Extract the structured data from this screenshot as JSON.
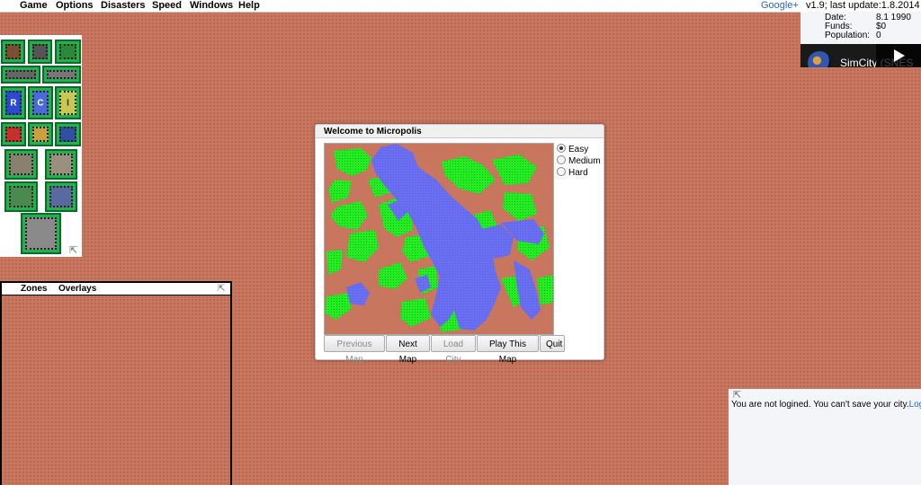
{
  "menubar": {
    "items": [
      "Game",
      "Options",
      "Disasters",
      "Speed",
      "Windows",
      "Help"
    ],
    "google_plus": "Google+",
    "version": "v1.9; last update:1.8.2014"
  },
  "status": {
    "date_label": "Date:",
    "date_value": "8.1 1990",
    "funds_label": "Funds:",
    "funds_value": "$0",
    "population_label": "Population:",
    "population_value": "0",
    "video_title": "SimCity (SNES"
  },
  "zones_panel": {
    "tabs": [
      "Zones",
      "Overlays"
    ]
  },
  "dialog": {
    "title": "Welcome to Micropolis",
    "difficulty": {
      "options": [
        "Easy",
        "Medium",
        "Hard"
      ],
      "selected": "Easy"
    },
    "buttons": {
      "previous_map": "Previous Map",
      "next_map": "Next Map",
      "load_city": "Load City",
      "play_this_map": "Play This Map",
      "quit": "Quit"
    }
  },
  "login": {
    "message": "You are not logined. You can't save your city.",
    "link": "Login"
  },
  "colors": {
    "terrain": "#c8765e",
    "water": "#6a6ef0",
    "trees": "#22ee22",
    "tool_green": "#22b14c",
    "link_blue": "#2a62c9"
  }
}
